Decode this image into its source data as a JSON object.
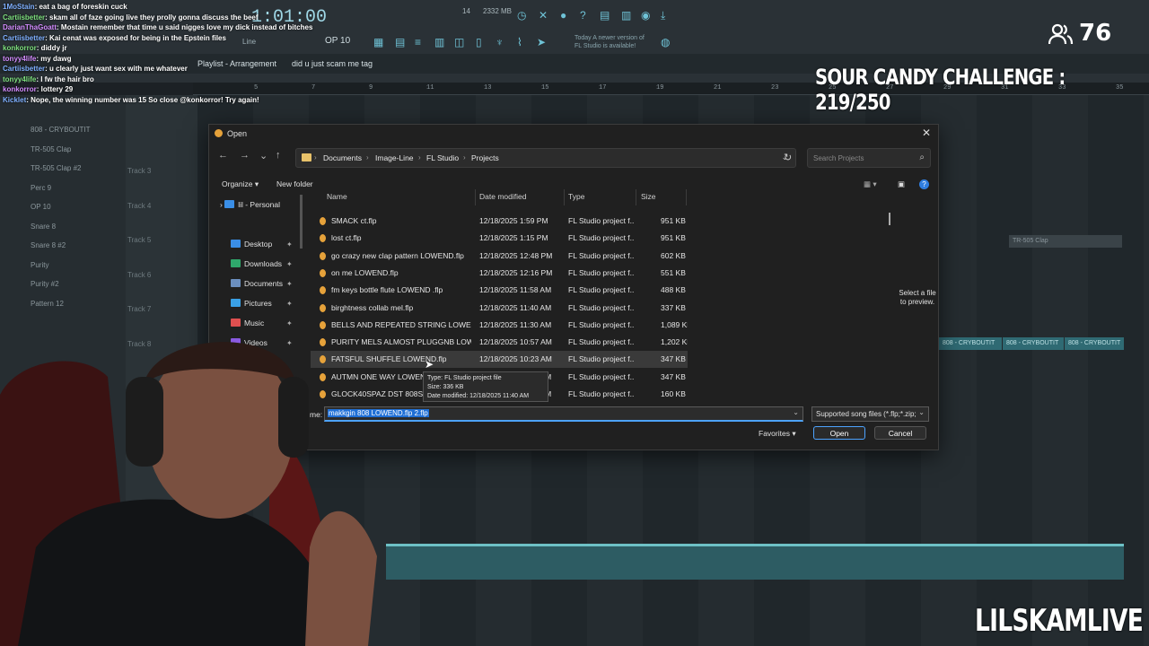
{
  "stream": {
    "viewer_count": "76",
    "challenge_text": "SOUR CANDY CHALLENGE : 219/250",
    "brand": "LILSKAMLIVE"
  },
  "chat": [
    {
      "user": "1MoStain",
      "text": ": eat a bag of foreskin cuck"
    },
    {
      "user": "Cartiisbetter",
      "text": ": skam all of faze going live they prolly gonna discuss the beef"
    },
    {
      "user": "DarianThaGoatt",
      "text": ": Mostain remember that time u said nigges love my dick instead of bitches"
    },
    {
      "user": "Cartiisbetter",
      "text": ": Kai cenat was exposed for being in the Epstein files"
    },
    {
      "user": "konkorror",
      "text": ": diddy jr"
    },
    {
      "user": "tonyy4life",
      "text": ": my dawg"
    },
    {
      "user": "Cartiisbetter",
      "text": ": u clearly just want sex with me whatever"
    },
    {
      "user": "tonyy4life",
      "text": ": I fw the hair bro"
    },
    {
      "user": "konkorror",
      "text": ": lottery 29"
    },
    {
      "user": "Kicklet",
      "text": ": Nope, the winning number was 15 So close @konkorror! Try again!"
    }
  ],
  "fl": {
    "time": "1:01:00",
    "tempo": "14",
    "memory": "2332 MB",
    "pattern": "OP 10",
    "hint_line1": "Today  A newer version of",
    "hint_line2": "FL Studio is available!",
    "playlist_title": "Playlist - Arrangement",
    "playlist_sub": "did u just scam me tag",
    "line_label": "Line",
    "ruler": [
      "5",
      "7",
      "9",
      "11",
      "13",
      "15",
      "17",
      "19",
      "21",
      "23",
      "25",
      "27",
      "29",
      "31",
      "33",
      "35",
      "37"
    ],
    "patterns": [
      "808 - CRYBOUTIT",
      "TR-505 Clap",
      "TR-505 Clap #2",
      "Perc 9",
      "OP 10",
      "Snare 8",
      "Snare 8 #2",
      "Purity",
      "Purity #2",
      "Pattern 12"
    ],
    "tracks": [
      "Track 3",
      "Track 4",
      "Track 5",
      "Track 6",
      "Track 7",
      "Track 8"
    ],
    "clip_clap": "TR-505 Clap",
    "clip_808": "808 - CRYBOUTIT"
  },
  "dialog": {
    "title": "Open",
    "breadcrumbs": [
      "Documents",
      "Image-Line",
      "FL Studio",
      "Projects"
    ],
    "search_placeholder": "Search Projects",
    "organize": "Organize",
    "new_folder": "New folder",
    "sidebar": [
      {
        "label": "lil - Personal",
        "icon": "cloud-icon",
        "color": "#3a8ee6"
      },
      {
        "label": "Desktop",
        "icon": "desktop-icon",
        "color": "#3a8ee6"
      },
      {
        "label": "Downloads",
        "icon": "download-icon",
        "color": "#2fa86c"
      },
      {
        "label": "Documents",
        "icon": "document-icon",
        "color": "#6b8fbf"
      },
      {
        "label": "Pictures",
        "icon": "picture-icon",
        "color": "#3aa0e6"
      },
      {
        "label": "Music",
        "icon": "music-icon",
        "color": "#e05050"
      },
      {
        "label": "Videos",
        "icon": "video-icon",
        "color": "#8a5ae0"
      }
    ],
    "columns": {
      "name": "Name",
      "date": "Date modified",
      "type": "Type",
      "size": "Size"
    },
    "files": [
      {
        "name": "SMACK ct.flp",
        "date": "12/18/2025 1:59 PM",
        "type": "FL Studio project f...",
        "size": "951 KB"
      },
      {
        "name": "lost ct.flp",
        "date": "12/18/2025 1:15 PM",
        "type": "FL Studio project f...",
        "size": "951 KB"
      },
      {
        "name": "go crazy new clap pattern LOWEND.flp",
        "date": "12/18/2025 12:48 PM",
        "type": "FL Studio project f...",
        "size": "602 KB"
      },
      {
        "name": "on me LOWEND.flp",
        "date": "12/18/2025 12:16 PM",
        "type": "FL Studio project f...",
        "size": "551 KB"
      },
      {
        "name": "fm keys bottle flute LOWEND .flp",
        "date": "12/18/2025 11:58 AM",
        "type": "FL Studio project f...",
        "size": "488 KB"
      },
      {
        "name": "birghtness collab mel.flp",
        "date": "12/18/2025 11:40 AM",
        "type": "FL Studio project f...",
        "size": "337 KB"
      },
      {
        "name": "BELLS AND REPEATED STRING LOWEND ...",
        "date": "12/18/2025 11:30 AM",
        "type": "FL Studio project f...",
        "size": "1,089 KB"
      },
      {
        "name": "PURITY MELS ALMOST PLUGGNB LOWE...",
        "date": "12/18/2025 10:57 AM",
        "type": "FL Studio project f...",
        "size": "1,202 KB"
      },
      {
        "name": "FATSFUL SHUFFLE LOWEND.flp",
        "date": "12/18/2025 10:23 AM",
        "type": "FL Studio project f...",
        "size": "347 KB"
      },
      {
        "name": "AUTMN ONE WAY LOWEND",
        "date": "12/18/2025 11:40 AM",
        "type": "FL Studio project f...",
        "size": "347 KB"
      },
      {
        "name": "GLOCK40SPAZ DST 808S_2.fl",
        "date": "12/18/2025 11:40 AM",
        "type": "FL Studio project f...",
        "size": "160 KB"
      }
    ],
    "tooltip": {
      "type": "Type: FL Studio project file",
      "size": "Size: 336 KB",
      "date": "Date modified: 12/18/2025 11:40 AM"
    },
    "preview_text": "Select a file to preview.",
    "filename_label": "me:",
    "filename_value": "makkgin 808 LOWEND.flp 2.flp",
    "filetype_value": "Supported song files (*.flp;*.zip;",
    "favorites": "Favorites",
    "open_label": "Open",
    "cancel_label": "Cancel"
  }
}
